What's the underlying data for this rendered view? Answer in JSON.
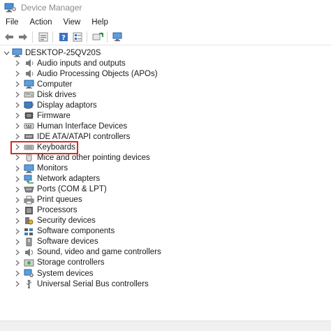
{
  "window": {
    "title": "Device Manager"
  },
  "menu": [
    {
      "label": "File"
    },
    {
      "label": "Action"
    },
    {
      "label": "View"
    },
    {
      "label": "Help"
    }
  ],
  "toolbar": {
    "icons": [
      "back-arrow-icon",
      "forward-arrow-icon",
      "properties-icon",
      "help-icon",
      "details-icon",
      "update-driver-icon",
      "monitor-icon"
    ]
  },
  "tree": {
    "root_label": "DESKTOP-25QV20S",
    "nodes": [
      {
        "label": "Audio inputs and outputs",
        "icon": "speaker-icon"
      },
      {
        "label": "Audio Processing Objects (APOs)",
        "icon": "speaker-icon"
      },
      {
        "label": "Computer",
        "icon": "computer-icon"
      },
      {
        "label": "Disk drives",
        "icon": "disk-icon"
      },
      {
        "label": "Display adaptors",
        "icon": "display-adapter-icon"
      },
      {
        "label": "Firmware",
        "icon": "firmware-icon"
      },
      {
        "label": "Human Interface Devices",
        "icon": "hid-icon"
      },
      {
        "label": "IDE ATA/ATAPI controllers",
        "icon": "ide-icon"
      },
      {
        "label": "Keyboards",
        "icon": "keyboard-icon"
      },
      {
        "label": "Mice and other pointing devices",
        "icon": "mouse-icon"
      },
      {
        "label": "Monitors",
        "icon": "monitor-icon"
      },
      {
        "label": "Network adapters",
        "icon": "network-icon"
      },
      {
        "label": "Ports (COM & LPT)",
        "icon": "port-icon"
      },
      {
        "label": "Print queues",
        "icon": "printer-icon"
      },
      {
        "label": "Processors",
        "icon": "processor-icon"
      },
      {
        "label": "Security devices",
        "icon": "security-icon"
      },
      {
        "label": "Software components",
        "icon": "software-component-icon"
      },
      {
        "label": "Software devices",
        "icon": "software-device-icon"
      },
      {
        "label": "Sound, video and game controllers",
        "icon": "sound-icon"
      },
      {
        "label": "Storage controllers",
        "icon": "storage-icon"
      },
      {
        "label": "System devices",
        "icon": "system-icon"
      },
      {
        "label": "Universal Serial Bus controllers",
        "icon": "usb-icon"
      }
    ]
  },
  "colors": {
    "highlight": "#d42a2a",
    "chevron": "#6b6b6b"
  }
}
